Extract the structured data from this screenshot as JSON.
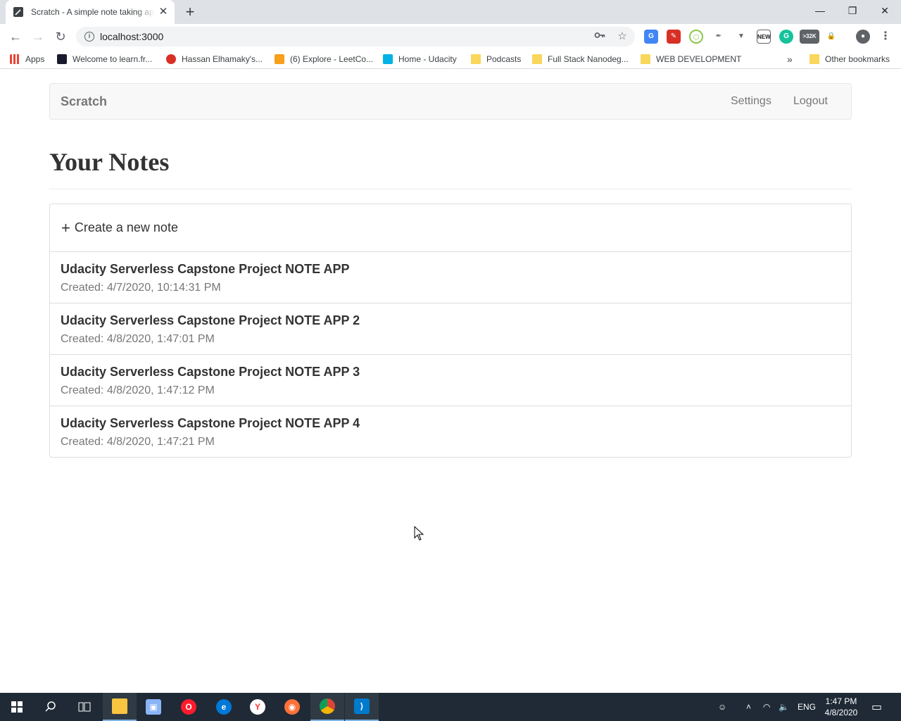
{
  "browser": {
    "tab_title": "Scratch - A simple note taking app",
    "url": "localhost:3000",
    "bookmarks": [
      {
        "label": "Apps",
        "color": "#4285f4"
      },
      {
        "label": "Welcome to learn.fr...",
        "color": "#1a1a2e"
      },
      {
        "label": "Hassan Elhamaky's...",
        "color": "#d93025"
      },
      {
        "label": "(6) Explore - LeetCo...",
        "color": "#f89f1b"
      },
      {
        "label": "Home - Udacity",
        "color": "#02b3e4"
      },
      {
        "label": "Podcasts",
        "color": "#f9d65c"
      },
      {
        "label": "Full Stack Nanodeg...",
        "color": "#f9d65c"
      },
      {
        "label": "WEB DEVELOPMENT",
        "color": "#f9d65c"
      }
    ],
    "bookmarks_overflow": "»",
    "other_bookmarks": "Other bookmarks",
    "ext_badge": ">32K",
    "ext_new": "NEW"
  },
  "navbar": {
    "brand": "Scratch",
    "settings": "Settings",
    "logout": "Logout"
  },
  "page": {
    "title": "Your Notes",
    "create_label": "Create a new note",
    "notes": [
      {
        "title": "Udacity Serverless Capstone Project NOTE APP",
        "created": "Created: 4/7/2020, 10:14:31 PM"
      },
      {
        "title": "Udacity Serverless Capstone Project NOTE APP 2",
        "created": "Created: 4/8/2020, 1:47:01 PM"
      },
      {
        "title": "Udacity Serverless Capstone Project NOTE APP 3",
        "created": "Created: 4/8/2020, 1:47:12 PM"
      },
      {
        "title": "Udacity Serverless Capstone Project NOTE APP 4",
        "created": "Created: 4/8/2020, 1:47:21 PM"
      }
    ]
  },
  "taskbar": {
    "language": "ENG",
    "time": "1:47 PM",
    "date": "4/8/2020"
  }
}
